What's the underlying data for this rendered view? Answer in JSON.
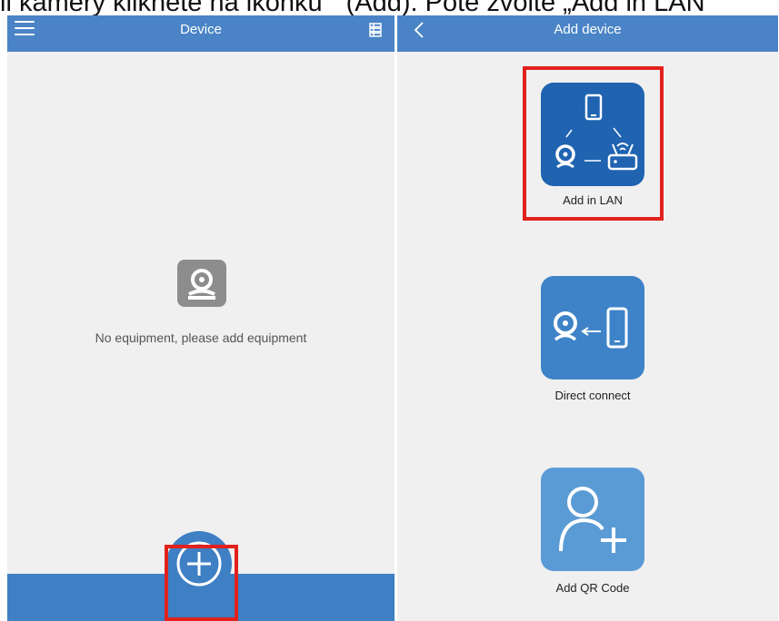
{
  "caption": {
    "part1": "ii kamery klikněte na ikonku",
    "part2": "(Add). Poté zvolte „Add in LAN\""
  },
  "left_screen": {
    "title": "Device",
    "empty_message": "No equipment, please add equipment",
    "menu_icon": "hamburger-menu-icon",
    "view_icon": "list-view-icon",
    "empty_icon": "camera-icon",
    "add_icon": "plus-circle-icon"
  },
  "right_screen": {
    "title": "Add device",
    "back_icon": "chevron-left-icon",
    "options": [
      {
        "label": "Add in LAN",
        "icon": "lan-network-icon",
        "highlighted": true
      },
      {
        "label": "Direct connect",
        "icon": "direct-connect-icon",
        "highlighted": false
      },
      {
        "label": "Add QR Code",
        "icon": "add-user-icon",
        "highlighted": false
      }
    ]
  },
  "colors": {
    "appbar": "#4a84c6",
    "panel_background": "#f0f0f0",
    "tile_dark": "#1f63b1",
    "tile_mid": "#3e83c8",
    "tile_light": "#5b9bd5",
    "highlight": "#e2211c"
  }
}
